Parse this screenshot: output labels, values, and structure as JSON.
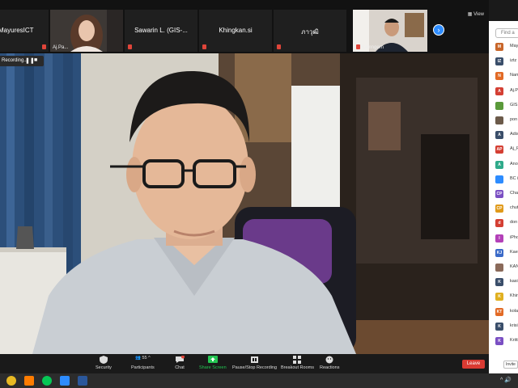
{
  "filmstrip": {
    "tiles": [
      {
        "name": "MayuresICT"
      },
      {
        "name": "Aj.Pa..."
      },
      {
        "name": "Sawarin L. (GIS-..."
      },
      {
        "name": "Khingkan.si"
      },
      {
        "name": "ภาวุฒิ"
      },
      {
        "name": "Namngern"
      }
    ],
    "view_label": "View"
  },
  "recording": {
    "label": "Recording..."
  },
  "toolbar": {
    "security": "Security",
    "participants": "Participants",
    "participants_count": "55",
    "chat": "Chat",
    "chat_badge": "2",
    "share_screen": "Share Screen",
    "recording": "Pause/Stop Recording",
    "breakout": "Breakout Rooms",
    "reactions": "Reactions",
    "leave": "Leave"
  },
  "panel": {
    "search_placeholder": "Find a",
    "invite": "Invite",
    "participants": [
      {
        "initials": "M",
        "name": "May",
        "color": "#c8662a"
      },
      {
        "initials": "IZ",
        "name": "iztz",
        "color": "#3a4e6a"
      },
      {
        "initials": "N",
        "name": "Nam",
        "color": "#e26a25"
      },
      {
        "initials": "A",
        "name": "Aj.P",
        "color": "#d43f33"
      },
      {
        "initials": "",
        "name": "GIS",
        "color": "#5a9a3a"
      },
      {
        "initials": "",
        "name": "pon",
        "color": "#6b5a4a"
      },
      {
        "initials": "A",
        "name": "Adis",
        "color": "#3a4e6a"
      },
      {
        "initials": "AP",
        "name": "Aj_P",
        "color": "#d43f33"
      },
      {
        "initials": "A",
        "name": "Ano",
        "color": "#2faa8a"
      },
      {
        "initials": "",
        "name": "BC i",
        "color": "#2d8cff"
      },
      {
        "initials": "CP",
        "name": "Cha",
        "color": "#7a4fc3"
      },
      {
        "initials": "CP",
        "name": "chut",
        "color": "#e09a1a"
      },
      {
        "initials": "d",
        "name": "don",
        "color": "#d43f33"
      },
      {
        "initials": "I",
        "name": "iPho",
        "color": "#b340b8"
      },
      {
        "initials": "KJ",
        "name": "Kae",
        "color": "#3a6ac8"
      },
      {
        "initials": "",
        "name": "KAN",
        "color": "#8a6a5a"
      },
      {
        "initials": "K",
        "name": "kasi",
        "color": "#3a4e6a"
      },
      {
        "initials": "K",
        "name": "Khin",
        "color": "#e0b020"
      },
      {
        "initials": "KT",
        "name": "kola",
        "color": "#e26a25"
      },
      {
        "initials": "K",
        "name": "krisi",
        "color": "#3a4e6a"
      },
      {
        "initials": "K",
        "name": "Kritt",
        "color": "#7a4fc3"
      }
    ]
  }
}
